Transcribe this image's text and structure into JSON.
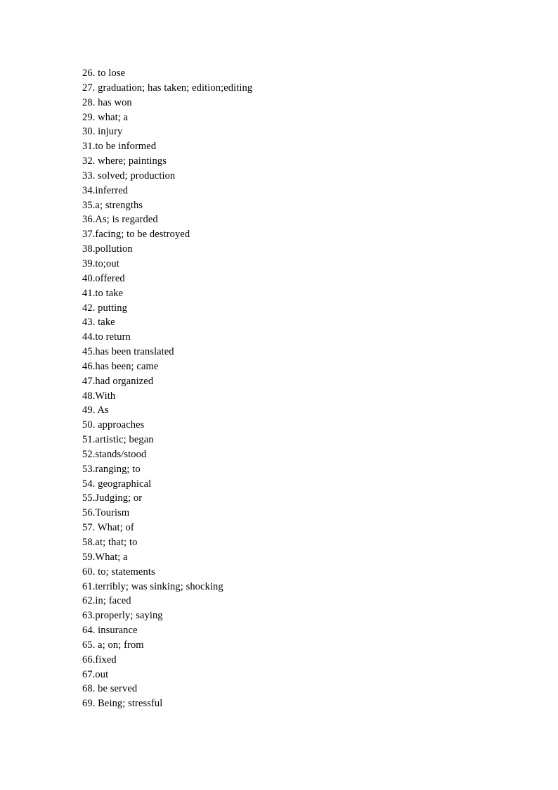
{
  "document": {
    "type": "answer-key",
    "background_color": "#ffffff",
    "text_color": "#000000",
    "answers": [
      "26. to lose",
      "27. graduation; has taken; edition;editing",
      "28. has won",
      "29. what; a",
      "30. injury",
      "31.to be informed",
      "32. where; paintings",
      "33. solved; production",
      "34.inferred",
      "35.a; strengths",
      "36.As; is regarded",
      "37.facing; to be destroyed",
      "38.pollution",
      "39.to;out",
      "40.offered",
      "41.to take",
      "42. putting",
      "43. take",
      "44.to return",
      "45.has been translated",
      "46.has been; came",
      "47.had organized",
      "48.With",
      "49. As",
      "50. approaches",
      "51.artistic; began",
      "52.stands/stood",
      "53.ranging; to",
      "54. geographical",
      "55.Judging; or",
      "56.Tourism",
      "57. What; of",
      "58.at; that; to",
      "59.What; a",
      "60. to; statements",
      "61.terribly; was sinking; shocking",
      "62.in; faced",
      "63.properly; saying",
      "64. insurance",
      "65. a; on; from",
      "66.fixed",
      "67.out",
      "68. be served",
      "69. Being; stressful"
    ]
  }
}
